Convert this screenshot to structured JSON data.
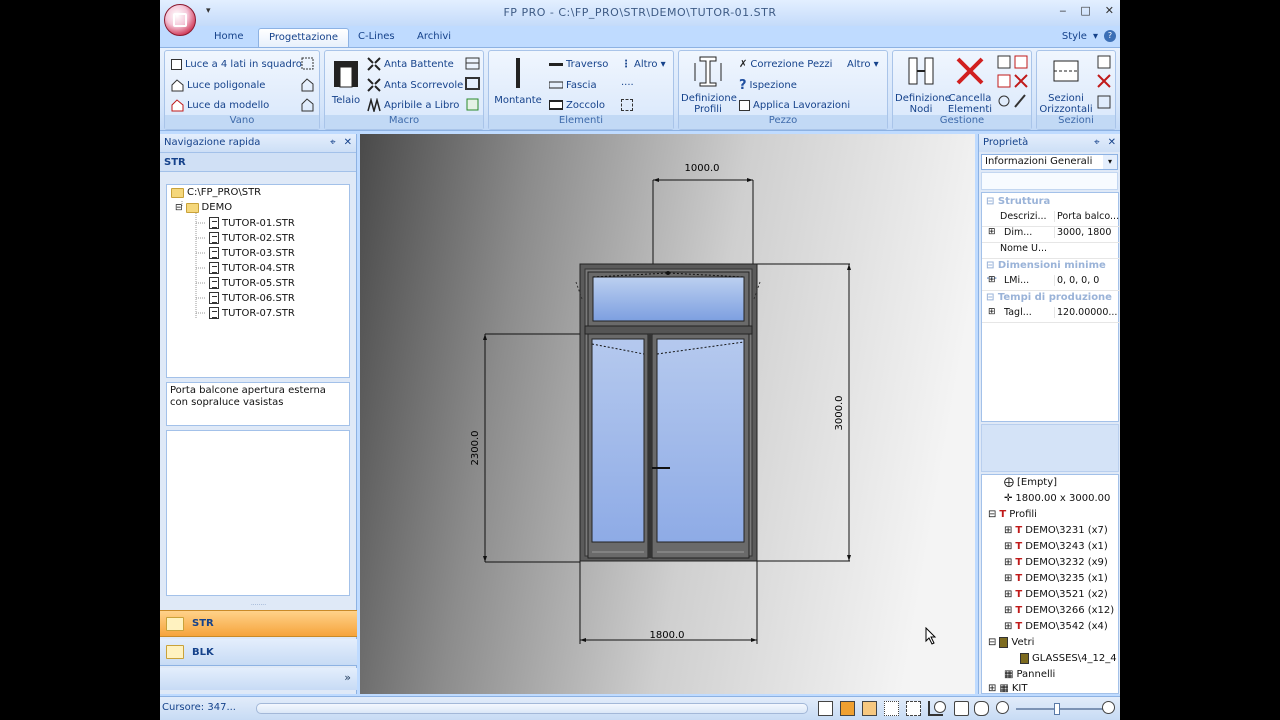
{
  "titlebar": {
    "title": "FP PRO - C:\\FP_PRO\\STR\\DEMO\\TUTOR-01.STR",
    "qat": "▾",
    "minimize": "‒",
    "restore": "□",
    "close": "✕"
  },
  "tabs": [
    {
      "label": "Home"
    },
    {
      "label": "Progettazione"
    },
    {
      "label": "C-Lines"
    },
    {
      "label": "Archivi"
    }
  ],
  "style_menu": {
    "label": "Style",
    "arrow": "▾",
    "help": "?"
  },
  "ribbon": {
    "vano": {
      "label": "Vano",
      "b1": "Luce a 4 lati in squadro",
      "b2": "Luce poligonale",
      "b3": "Luce da modello"
    },
    "macro": {
      "label": "Macro",
      "telaio": "Telaio",
      "b1": "Anta Battente",
      "b2": "Anta Scorrevole",
      "b3": "Apribile a Libro"
    },
    "elementi": {
      "label": "Elementi",
      "montante": "Montante",
      "b1": "Traverso",
      "b2": "Fascia",
      "b3": "Zoccolo",
      "altro": "Altro"
    },
    "pezzo": {
      "label": "Pezzo",
      "def1": "Definizione",
      "def2": "Profili",
      "b1": "Correzione Pezzi",
      "b2": "Ispezione",
      "b3": "Applica Lavorazioni",
      "altro": "Altro"
    },
    "gestione": {
      "label": "Gestione",
      "def1": "Definizione",
      "def2": "Nodi",
      "canc1": "Cancella",
      "canc2": "Elementi"
    },
    "sezioni": {
      "label": "Sezioni",
      "s1": "Sezioni",
      "s2": "Orizzontali"
    }
  },
  "left_panel": {
    "header": "Navigazione rapida",
    "pin": "⌖",
    "close": "✕",
    "sub": "STR",
    "tree": [
      {
        "label": "C:\\FP_PRO\\STR"
      },
      {
        "label": "DEMO"
      },
      {
        "label": "TUTOR-01.STR"
      },
      {
        "label": "TUTOR-02.STR"
      },
      {
        "label": "TUTOR-03.STR"
      },
      {
        "label": "TUTOR-04.STR"
      },
      {
        "label": "TUTOR-05.STR"
      },
      {
        "label": "TUTOR-06.STR"
      },
      {
        "label": "TUTOR-07.STR"
      }
    ],
    "description": "Porta balcone apertura esterna con sopraluce vasistas",
    "nav_buttons": [
      {
        "label": "STR"
      },
      {
        "label": "BLK"
      }
    ],
    "more": "»"
  },
  "drawing": {
    "dim_top": "1000.0",
    "dim_bottom": "1800.0",
    "dim_left": "2300.0",
    "dim_right": "3000.0"
  },
  "right_panel": {
    "header": "Proprietà",
    "pin": "⌖",
    "close": "✕",
    "combo": "Informazioni Generali",
    "combo_arrow": "▾",
    "categories": [
      {
        "label": "Struttura"
      },
      {
        "label": "Dimensioni minime ..."
      },
      {
        "label": "Tempi di produzione"
      }
    ],
    "rows": [
      {
        "key": "Descrizi...",
        "value": "Porta balco..."
      },
      {
        "key": "Dim...",
        "value": "3000, 1800"
      },
      {
        "key": "Nome U...",
        "value": ""
      },
      {
        "key": "LMi...",
        "value": "0, 0, 0, 0"
      },
      {
        "key": "Tagl...",
        "value": "120.00000..."
      }
    ],
    "tree": [
      {
        "label": "[Empty]"
      },
      {
        "label": "1800.00 x 3000.00"
      },
      {
        "label": "Profili"
      },
      {
        "label": "DEMO\\3231 (x7)"
      },
      {
        "label": "DEMO\\3243 (x1)"
      },
      {
        "label": "DEMO\\3232 (x9)"
      },
      {
        "label": "DEMO\\3235 (x1)"
      },
      {
        "label": "DEMO\\3521 (x2)"
      },
      {
        "label": "DEMO\\3266 (x12)"
      },
      {
        "label": "DEMO\\3542 (x4)"
      },
      {
        "label": "Vetri"
      },
      {
        "label": "GLASSES\\4_12_4"
      },
      {
        "label": "Pannelli"
      },
      {
        "label": "KIT"
      }
    ]
  },
  "statusbar": {
    "cursor": "Cursore:   347..."
  }
}
